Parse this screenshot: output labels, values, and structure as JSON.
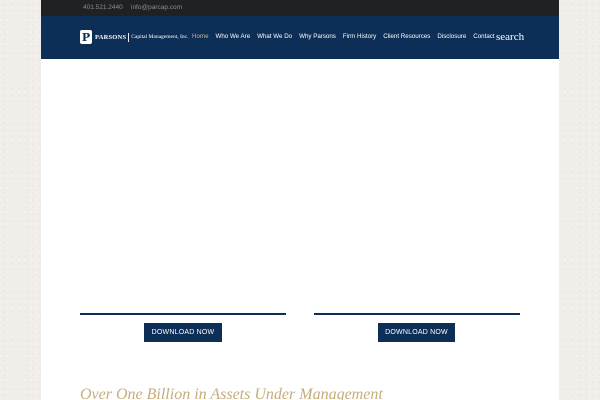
{
  "topbar": {
    "phone": "401.521.2440",
    "email": "info@parcap.com"
  },
  "header": {
    "logo": {
      "letter": "P",
      "name": "PARSONS",
      "subtitle": "Capital Management, Inc."
    },
    "nav": [
      {
        "label": "Home",
        "active": true
      },
      {
        "label": "Who We Are"
      },
      {
        "label": "What We Do"
      },
      {
        "label": "Why Parsons"
      },
      {
        "label": "Firm History"
      },
      {
        "label": "Client Resources"
      },
      {
        "label": "Disclosure"
      },
      {
        "label": "Contact"
      }
    ],
    "search_label": "search"
  },
  "main": {
    "download_left": "DOWNLOAD NOW",
    "download_right": "DOWNLOAD NOW",
    "tagline": "Over One Billion in Assets Under Management"
  },
  "colors": {
    "navy": "#0d2f57",
    "gold": "#c5ad7c",
    "topbar": "#1f2122"
  }
}
